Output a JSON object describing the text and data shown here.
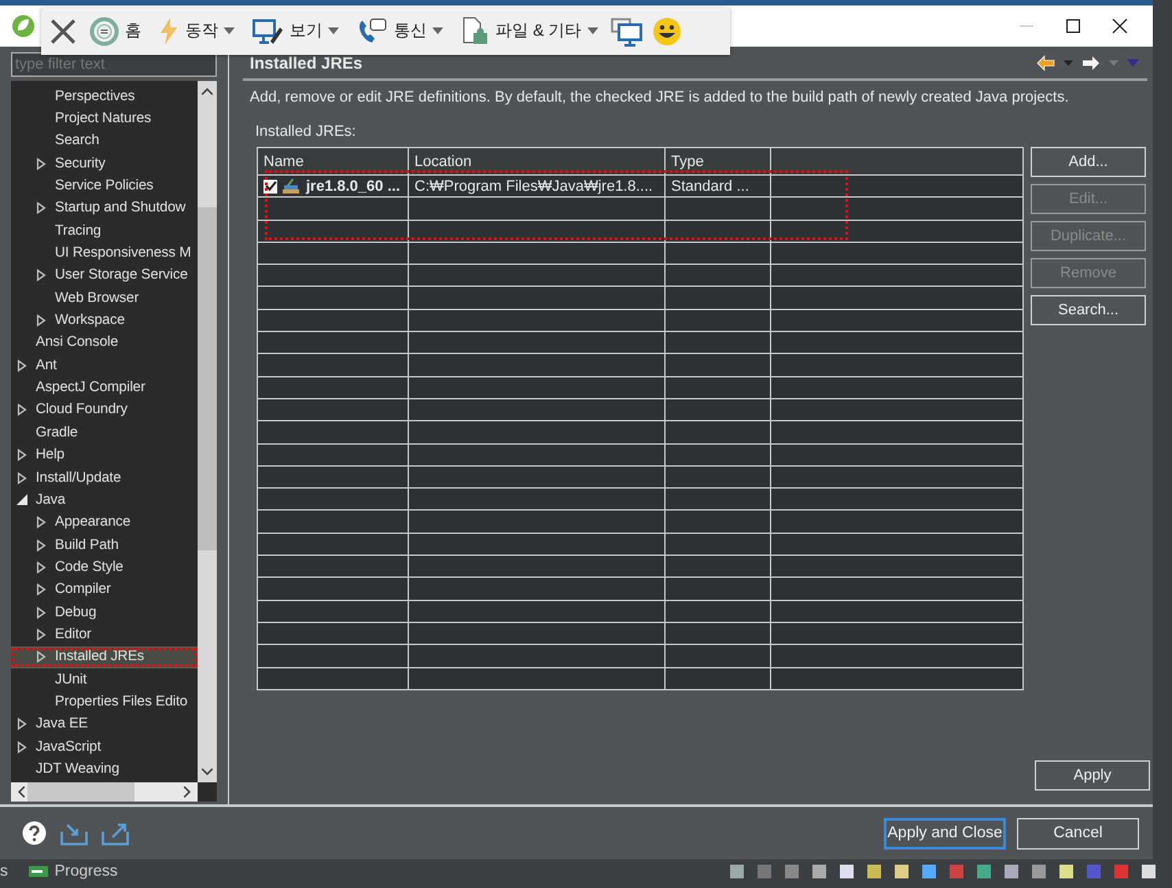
{
  "remote_toolbar": {
    "items": [
      {
        "label": "홈",
        "dropdown": false
      },
      {
        "label": "동작",
        "dropdown": true
      },
      {
        "label": "보기",
        "dropdown": true
      },
      {
        "label": "통신",
        "dropdown": true
      },
      {
        "label": "파일 & 기타",
        "dropdown": true
      }
    ]
  },
  "sidebar": {
    "filter": {
      "placeholder": "type filter text"
    },
    "continued_children": [
      {
        "label": "Perspectives",
        "kind": "leaf",
        "selected": false
      },
      {
        "label": "Project Natures",
        "kind": "leaf",
        "selected": false
      },
      {
        "label": "Search",
        "kind": "leaf",
        "selected": false
      },
      {
        "label": "Security",
        "kind": "folder",
        "expanded": false,
        "selected": false
      },
      {
        "label": "Service Policies",
        "kind": "leaf",
        "selected": false
      },
      {
        "label": "Startup and Shutdow",
        "kind": "folder",
        "expanded": false,
        "selected": false
      },
      {
        "label": "Tracing",
        "kind": "leaf",
        "selected": false
      },
      {
        "label": "UI Responsiveness M",
        "kind": "leaf",
        "selected": false
      },
      {
        "label": "User Storage Service",
        "kind": "folder",
        "expanded": false,
        "selected": false
      },
      {
        "label": "Web Browser",
        "kind": "leaf",
        "selected": false
      },
      {
        "label": "Workspace",
        "kind": "folder",
        "expanded": false,
        "selected": false
      }
    ],
    "items": [
      {
        "label": "Ansi Console",
        "kind": "leaf",
        "selected": false
      },
      {
        "label": "Ant",
        "kind": "folder",
        "expanded": false,
        "selected": false
      },
      {
        "label": "AspectJ Compiler",
        "kind": "leaf",
        "selected": false
      },
      {
        "label": "Cloud Foundry",
        "kind": "folder",
        "expanded": false,
        "selected": false
      },
      {
        "label": "Gradle",
        "kind": "leaf",
        "selected": false
      },
      {
        "label": "Help",
        "kind": "folder",
        "expanded": false,
        "selected": false
      },
      {
        "label": "Install/Update",
        "kind": "folder",
        "expanded": false,
        "selected": false
      },
      {
        "label": "Java",
        "kind": "folder",
        "expanded": true,
        "selected": false,
        "children": [
          {
            "label": "Appearance",
            "kind": "folder",
            "expanded": false,
            "selected": false
          },
          {
            "label": "Build Path",
            "kind": "folder",
            "expanded": false,
            "selected": false
          },
          {
            "label": "Code Style",
            "kind": "folder",
            "expanded": false,
            "selected": false
          },
          {
            "label": "Compiler",
            "kind": "folder",
            "expanded": false,
            "selected": false
          },
          {
            "label": "Debug",
            "kind": "folder",
            "expanded": false,
            "selected": false
          },
          {
            "label": "Editor",
            "kind": "folder",
            "expanded": false,
            "selected": false
          },
          {
            "label": "Installed JREs",
            "kind": "folder",
            "expanded": false,
            "selected": true
          },
          {
            "label": "JUnit",
            "kind": "leaf",
            "selected": false
          },
          {
            "label": "Properties Files Edito",
            "kind": "leaf",
            "selected": false
          }
        ]
      },
      {
        "label": "Java EE",
        "kind": "folder",
        "expanded": false,
        "selected": false
      },
      {
        "label": "JavaScript",
        "kind": "folder",
        "expanded": false,
        "selected": false
      },
      {
        "label": "JDT Weaving",
        "kind": "leaf",
        "selected": false
      }
    ]
  },
  "page": {
    "title": "Installed JREs",
    "description": "Add, remove or edit JRE definitions. By default, the checked JRE is added to the build path of newly created Java projects.",
    "table_label": "Installed JREs:",
    "table": {
      "columns": [
        "Name",
        "Location",
        "Type"
      ],
      "rows": [
        {
          "checked": true,
          "name": "jre1.8.0_60 ...",
          "location": "C:₩Program Files₩Java₩jre1.8....",
          "type": "Standard ..."
        }
      ]
    },
    "buttons": [
      {
        "label": "Add...",
        "disabled": false
      },
      {
        "label": "Edit...",
        "disabled": true
      },
      {
        "label": "Duplicate...",
        "disabled": true
      },
      {
        "label": "Remove",
        "disabled": true
      },
      {
        "label": "Search...",
        "disabled": false
      }
    ],
    "apply": "Apply"
  },
  "footer": {
    "buttons": [
      {
        "label": "Apply and Close",
        "default": true
      },
      {
        "label": "Cancel",
        "default": false
      }
    ]
  },
  "status_bar": {
    "fragment": "s",
    "progress": "Progress"
  }
}
